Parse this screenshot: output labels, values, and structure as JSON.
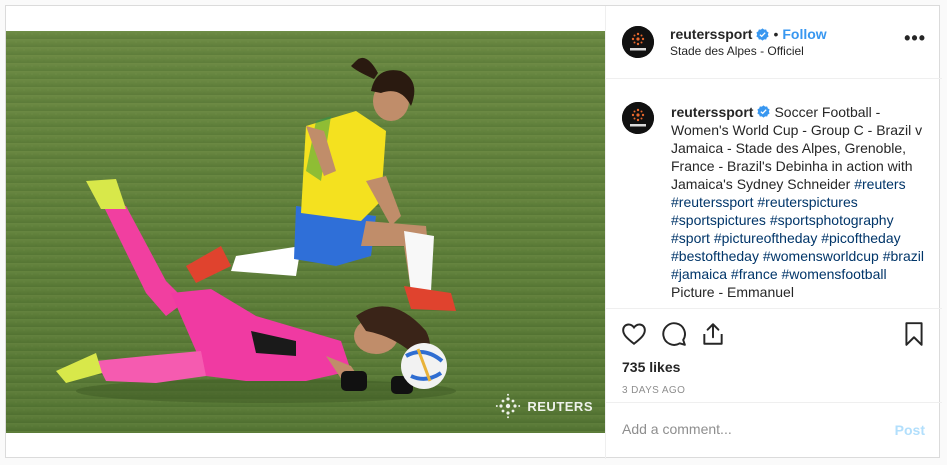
{
  "post": {
    "username": "reuterssport",
    "follow_label": "Follow",
    "separator": "•",
    "location": "Stade des Alpes - Officiel",
    "more_icon": "more-dots-icon",
    "more_label": "•••"
  },
  "photo": {
    "watermark_text": "REUTERS",
    "subject": "soccer-tackle-photo"
  },
  "caption": {
    "username": "reuterssport",
    "text": "Soccer Football - Women's World Cup - Group C - Brazil v Jamaica - Stade des Alpes, Grenoble, France - Brazil's Debinha in action with Jamaica's Sydney Schneider",
    "hashtags": [
      "#reuters",
      "#reuterssport",
      "#reuterspictures",
      "#sportspictures",
      "#sportsphotography",
      "#sport",
      "#pictureoftheday",
      "#picoftheday",
      "#bestoftheday",
      "#womensworldcup",
      "#brazil",
      "#jamaica",
      "#france",
      "#womensfootball"
    ],
    "trailing_text": "Picture - Emmanuel"
  },
  "actions": {
    "like_icon": "heart-icon",
    "comment_icon": "comment-icon",
    "share_icon": "share-icon",
    "save_icon": "bookmark-icon"
  },
  "stats": {
    "likes": "735 likes",
    "time": "3 DAYS AGO"
  },
  "comment": {
    "placeholder": "Add a comment...",
    "post_label": "Post"
  },
  "colors": {
    "accent": "#3897f0",
    "hashtag": "#003569",
    "post_disabled": "#b2dffc",
    "border": "#dbdbdb"
  }
}
